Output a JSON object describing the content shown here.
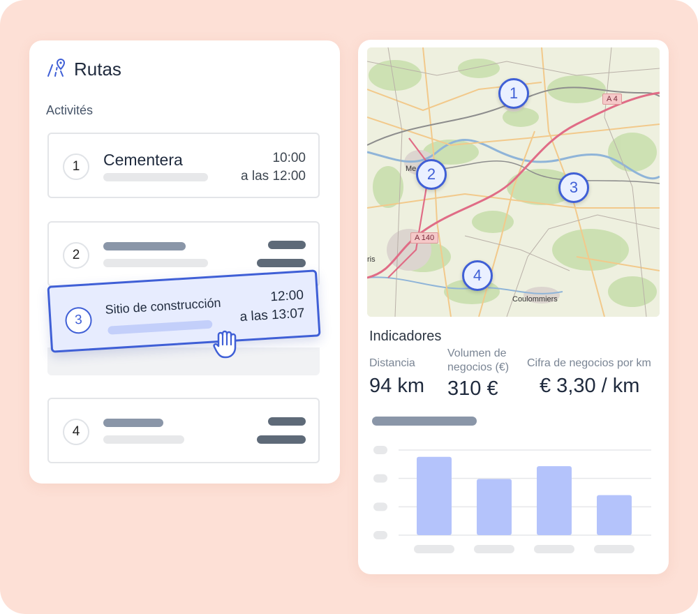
{
  "left_panel": {
    "app_title": "Rutas",
    "section_label": "Activités",
    "rows": [
      {
        "number": "1",
        "title": "Cementera",
        "time_start": "10:00",
        "time_end": "a las 12:00"
      },
      {
        "number": "2"
      },
      {
        "number": "3",
        "title": "Sitio de construcción",
        "time_start": "12:00",
        "time_end": "a las 13:07",
        "state": "dragging"
      },
      {
        "number": "4"
      }
    ]
  },
  "map": {
    "pins": [
      "1",
      "2",
      "3",
      "4"
    ],
    "road_labels": [
      "A 4",
      "A 140"
    ],
    "place_labels": [
      "Me",
      "Coulommiers",
      "ris"
    ]
  },
  "indicators": {
    "title": "Indicadores",
    "metrics": [
      {
        "label_line1": "Distancia",
        "label_line2": "",
        "value": "94 km"
      },
      {
        "label_line1": "Volumen de",
        "label_line2": "negocios (€)",
        "value": "310 €"
      },
      {
        "label_line1": "Cifra de negocios por km",
        "label_line2": "",
        "value": "€ 3,30 / km"
      }
    ]
  },
  "chart_data": {
    "type": "bar",
    "values": [
      0.92,
      0.66,
      0.81,
      0.47
    ],
    "bar_color": "#b4c3fb",
    "grid": true
  },
  "colors": {
    "accent": "#3f5fd6",
    "backdrop": "#fde0d6",
    "drag_card_bg": "#e7ecfe"
  }
}
